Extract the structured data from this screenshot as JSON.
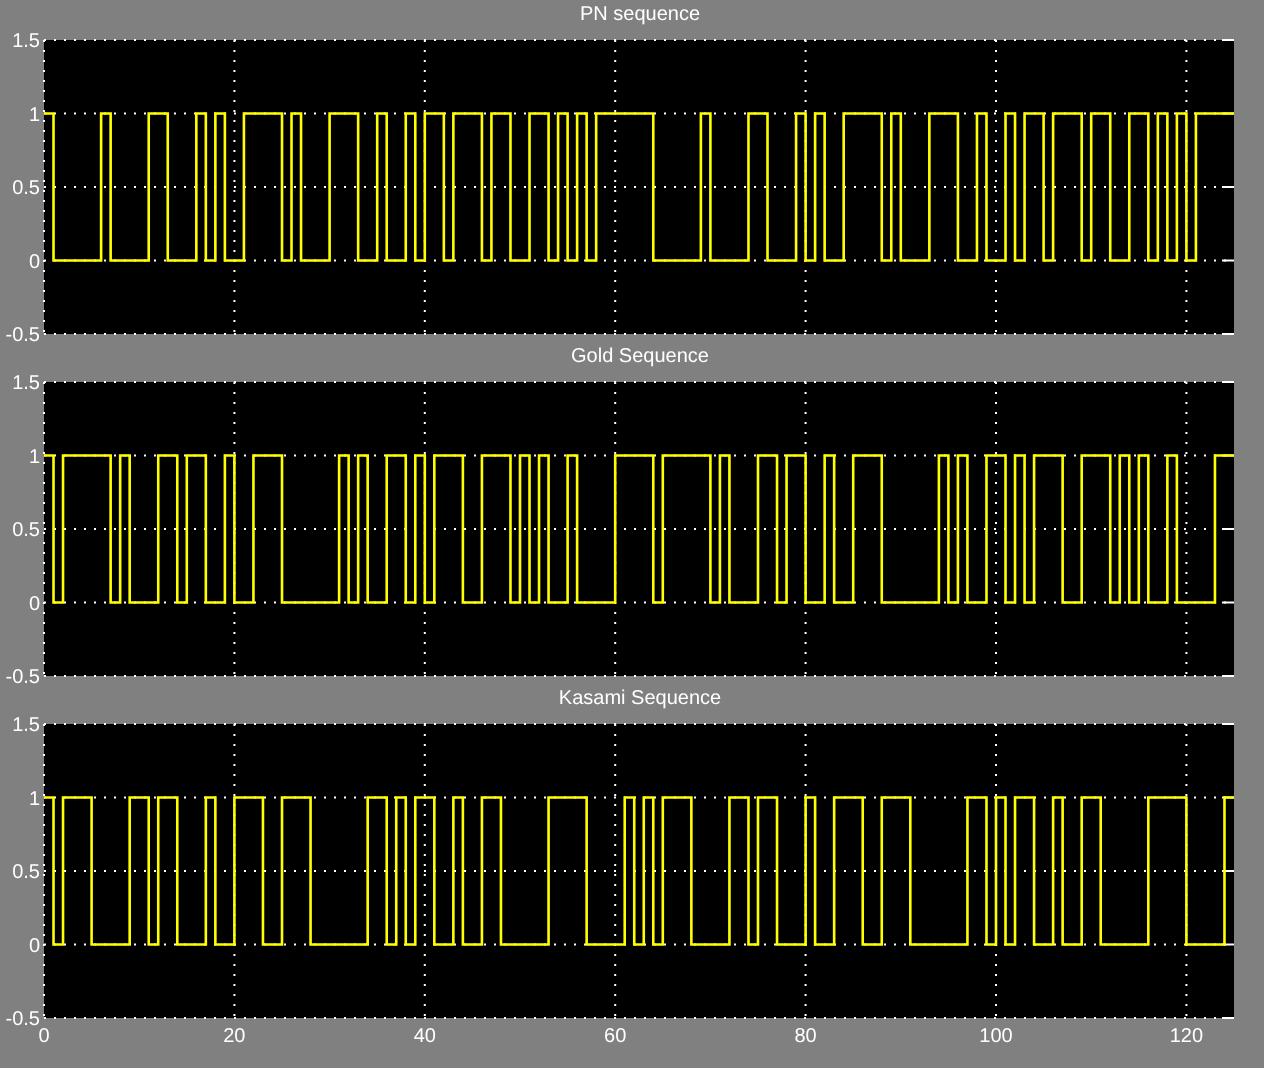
{
  "plots": [
    {
      "chart_data": {
        "type": "line",
        "title": "PN sequence",
        "grid": true,
        "xlim": [
          0,
          125
        ],
        "ylim": [
          -0.5,
          1.5
        ],
        "yticks": [
          -0.5,
          0,
          0.5,
          1,
          1.5
        ],
        "x": [
          0,
          1,
          1,
          6,
          6,
          7,
          7,
          11,
          11,
          13,
          13,
          16,
          16,
          17,
          17,
          18,
          18,
          19,
          19,
          21,
          21,
          25,
          25,
          26,
          26,
          27,
          27,
          30,
          30,
          33,
          33,
          35,
          35,
          36,
          36,
          38,
          38,
          39,
          39,
          40,
          40,
          42,
          42,
          43,
          43,
          46,
          46,
          47,
          47,
          49,
          49,
          51,
          51,
          53,
          53,
          54,
          54,
          55,
          55,
          56,
          56,
          57,
          57,
          58,
          58,
          64,
          64,
          69,
          69,
          70,
          70,
          74,
          74,
          76,
          76,
          79,
          79,
          80,
          80,
          81,
          81,
          82,
          82,
          84,
          84,
          88,
          88,
          89,
          89,
          90,
          90,
          93,
          93,
          96,
          96,
          98,
          98,
          99,
          99,
          101,
          101,
          102,
          102,
          103,
          103,
          105,
          105,
          106,
          106,
          109,
          109,
          110,
          110,
          112,
          112,
          114,
          114,
          116,
          116,
          117,
          117,
          118,
          118,
          119,
          119,
          120,
          120,
          121,
          121,
          125
        ],
        "series": [
          {
            "color": "#ffff00",
            "values": [
              1,
              1,
              0,
              0,
              1,
              1,
              0,
              0,
              1,
              1,
              0,
              0,
              1,
              1,
              0,
              0,
              1,
              1,
              0,
              0,
              1,
              1,
              0,
              0,
              1,
              1,
              0,
              0,
              1,
              1,
              0,
              0,
              1,
              1,
              0,
              0,
              1,
              1,
              0,
              0,
              1,
              1,
              0,
              0,
              1,
              1,
              0,
              0,
              1,
              1,
              0,
              0,
              1,
              1,
              0,
              0,
              1,
              1,
              0,
              0,
              1,
              1,
              0,
              0,
              1,
              1,
              0,
              0,
              1,
              1,
              0,
              0,
              1,
              1,
              0,
              0,
              1,
              1,
              0,
              0,
              1,
              1,
              0,
              0,
              1,
              1,
              0,
              0,
              1,
              1,
              0,
              0,
              1,
              1,
              0,
              0,
              1,
              1,
              0,
              0,
              1,
              1,
              0,
              0,
              1,
              1,
              0,
              0,
              1,
              1,
              0,
              0,
              1,
              1,
              0,
              0,
              1,
              1,
              0,
              0,
              1,
              1,
              0,
              0,
              1,
              1,
              0,
              0,
              1,
              1
            ]
          }
        ]
      }
    },
    {
      "chart_data": {
        "type": "line",
        "title": "Gold Sequence",
        "grid": true,
        "xlim": [
          0,
          125
        ],
        "ylim": [
          -0.5,
          1.5
        ],
        "yticks": [
          -0.5,
          0,
          0.5,
          1,
          1.5
        ],
        "x": [
          0,
          1,
          1,
          2,
          2,
          7,
          7,
          8,
          8,
          9,
          9,
          12,
          12,
          14,
          14,
          15,
          15,
          17,
          17,
          19,
          19,
          20,
          20,
          22,
          22,
          25,
          25,
          31,
          31,
          32,
          32,
          33,
          33,
          34,
          34,
          36,
          36,
          38,
          38,
          39,
          39,
          40,
          40,
          41,
          41,
          44,
          44,
          46,
          46,
          49,
          49,
          50,
          50,
          51,
          51,
          52,
          52,
          53,
          53,
          55,
          55,
          56,
          56,
          60,
          60,
          64,
          64,
          65,
          65,
          70,
          70,
          71,
          71,
          72,
          72,
          75,
          75,
          77,
          77,
          78,
          78,
          80,
          80,
          82,
          82,
          83,
          83,
          85,
          85,
          88,
          88,
          94,
          94,
          95,
          95,
          96,
          96,
          97,
          97,
          99,
          99,
          101,
          101,
          102,
          102,
          103,
          103,
          104,
          104,
          107,
          107,
          109,
          109,
          112,
          112,
          113,
          113,
          114,
          114,
          115,
          115,
          116,
          116,
          118,
          118,
          119,
          119,
          123,
          123,
          125
        ],
        "series": [
          {
            "color": "#ffff00",
            "values": [
              1,
              1,
              0,
              0,
              1,
              1,
              0,
              0,
              1,
              1,
              0,
              0,
              1,
              1,
              0,
              0,
              1,
              1,
              0,
              0,
              1,
              1,
              0,
              0,
              1,
              1,
              0,
              0,
              1,
              1,
              0,
              0,
              1,
              1,
              0,
              0,
              1,
              1,
              0,
              0,
              1,
              1,
              0,
              0,
              1,
              1,
              0,
              0,
              1,
              1,
              0,
              0,
              1,
              1,
              0,
              0,
              1,
              1,
              0,
              0,
              1,
              1,
              0,
              0,
              1,
              1,
              0,
              0,
              1,
              1,
              0,
              0,
              1,
              1,
              0,
              0,
              1,
              1,
              0,
              0,
              1,
              1,
              0,
              0,
              1,
              1,
              0,
              0,
              1,
              1,
              0,
              0,
              1,
              1,
              0,
              0,
              1,
              1,
              0,
              0,
              1,
              1,
              0,
              0,
              1,
              1,
              0,
              0,
              1,
              1,
              0,
              0,
              1,
              1,
              0,
              0,
              1,
              1,
              0,
              0,
              1,
              1,
              0,
              0,
              1,
              1,
              0,
              0,
              1,
              1
            ]
          }
        ]
      }
    },
    {
      "chart_data": {
        "type": "line",
        "title": "Kasami Sequence",
        "grid": true,
        "xlim": [
          0,
          125
        ],
        "ylim": [
          -0.5,
          1.5
        ],
        "yticks": [
          -0.5,
          0,
          0.5,
          1,
          1.5
        ],
        "xticks": [
          0,
          20,
          40,
          60,
          80,
          100,
          120
        ],
        "x": [
          0,
          1,
          1,
          2,
          2,
          5,
          5,
          9,
          9,
          11,
          11,
          12,
          12,
          14,
          14,
          17,
          17,
          18,
          18,
          20,
          20,
          23,
          23,
          25,
          25,
          28,
          28,
          34,
          34,
          36,
          36,
          37,
          37,
          38,
          38,
          39,
          39,
          41,
          41,
          43,
          43,
          44,
          44,
          46,
          46,
          48,
          48,
          53,
          53,
          57,
          57,
          61,
          61,
          62,
          62,
          63,
          63,
          64,
          64,
          65,
          65,
          68,
          68,
          72,
          72,
          74,
          74,
          75,
          75,
          77,
          77,
          80,
          80,
          81,
          81,
          83,
          83,
          86,
          86,
          88,
          88,
          91,
          91,
          97,
          97,
          99,
          99,
          100,
          100,
          101,
          101,
          102,
          102,
          104,
          104,
          106,
          106,
          107,
          107,
          109,
          109,
          111,
          111,
          116,
          116,
          120,
          120,
          124,
          124,
          125
        ],
        "series": [
          {
            "color": "#ffff00",
            "values": [
              1,
              1,
              0,
              0,
              1,
              1,
              0,
              0,
              1,
              1,
              0,
              0,
              1,
              1,
              0,
              0,
              1,
              1,
              0,
              0,
              1,
              1,
              0,
              0,
              1,
              1,
              0,
              0,
              1,
              1,
              0,
              0,
              1,
              1,
              0,
              0,
              1,
              1,
              0,
              0,
              1,
              1,
              0,
              0,
              1,
              1,
              0,
              0,
              1,
              1,
              0,
              0,
              1,
              1,
              0,
              0,
              1,
              1,
              0,
              0,
              1,
              1,
              0,
              0,
              1,
              1,
              0,
              0,
              1,
              1,
              0,
              0,
              1,
              1,
              0,
              0,
              1,
              1,
              0,
              0,
              1,
              1,
              0,
              0,
              1,
              1,
              0,
              0,
              1,
              1,
              0,
              0,
              1,
              1,
              0,
              0,
              1,
              1,
              0,
              0,
              1,
              1,
              0,
              0,
              1,
              1,
              0,
              0,
              1,
              1
            ]
          }
        ]
      }
    }
  ]
}
